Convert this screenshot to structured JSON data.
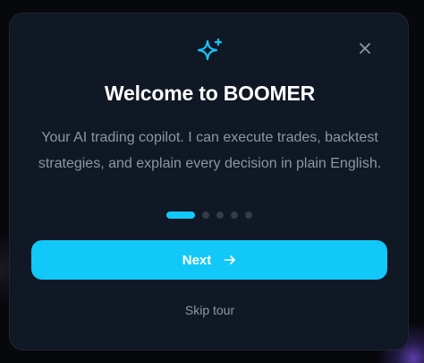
{
  "onboarding": {
    "title": "Welcome to BOOMER",
    "description": "Your AI trading copilot. I can execute trades, backtest strategies, and explain every decision in plain English.",
    "steps_total": 5,
    "current_step": 1,
    "next_label": "Next",
    "skip_label": "Skip tour",
    "icons": {
      "header": "sparkle-icon",
      "close": "close-icon",
      "next": "arrow-right-icon"
    }
  },
  "colors": {
    "accent": "#12c8f8",
    "card_background": "#101725",
    "text_primary": "#ffffff",
    "text_secondary": "#8f96a3",
    "dot_inactive": "#353c48"
  }
}
